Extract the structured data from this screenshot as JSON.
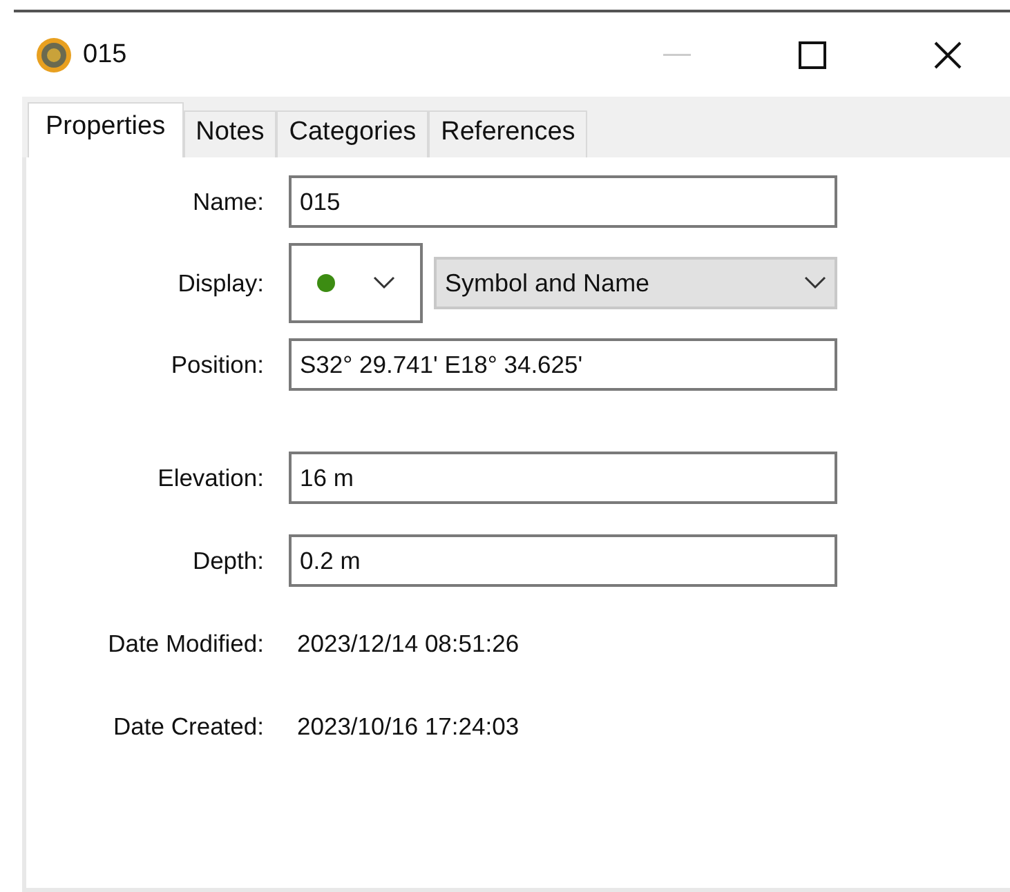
{
  "window": {
    "title": "015"
  },
  "tabs": [
    {
      "label": "Properties",
      "selected": true
    },
    {
      "label": "Notes",
      "selected": false
    },
    {
      "label": "Categories",
      "selected": false
    },
    {
      "label": "References",
      "selected": false
    }
  ],
  "sections": [
    [
      {
        "kind": "text",
        "label": "Name:",
        "value": "015"
      },
      {
        "kind": "display",
        "label": "Display:",
        "value": "Symbol and Name"
      },
      {
        "kind": "text",
        "label": "Position:",
        "value": "S32° 29.741' E18° 34.625'"
      }
    ],
    [
      {
        "kind": "text",
        "label": "Elevation:",
        "value": "16 m"
      },
      {
        "kind": "text",
        "label": "Depth:",
        "value": "0.2 m"
      },
      {
        "kind": "info",
        "label": "Date Modified:",
        "value": "2023/12/14 08:51:26"
      },
      {
        "kind": "info",
        "label": "Date Created:",
        "value": "2023/10/16 17:24:03"
      }
    ]
  ]
}
